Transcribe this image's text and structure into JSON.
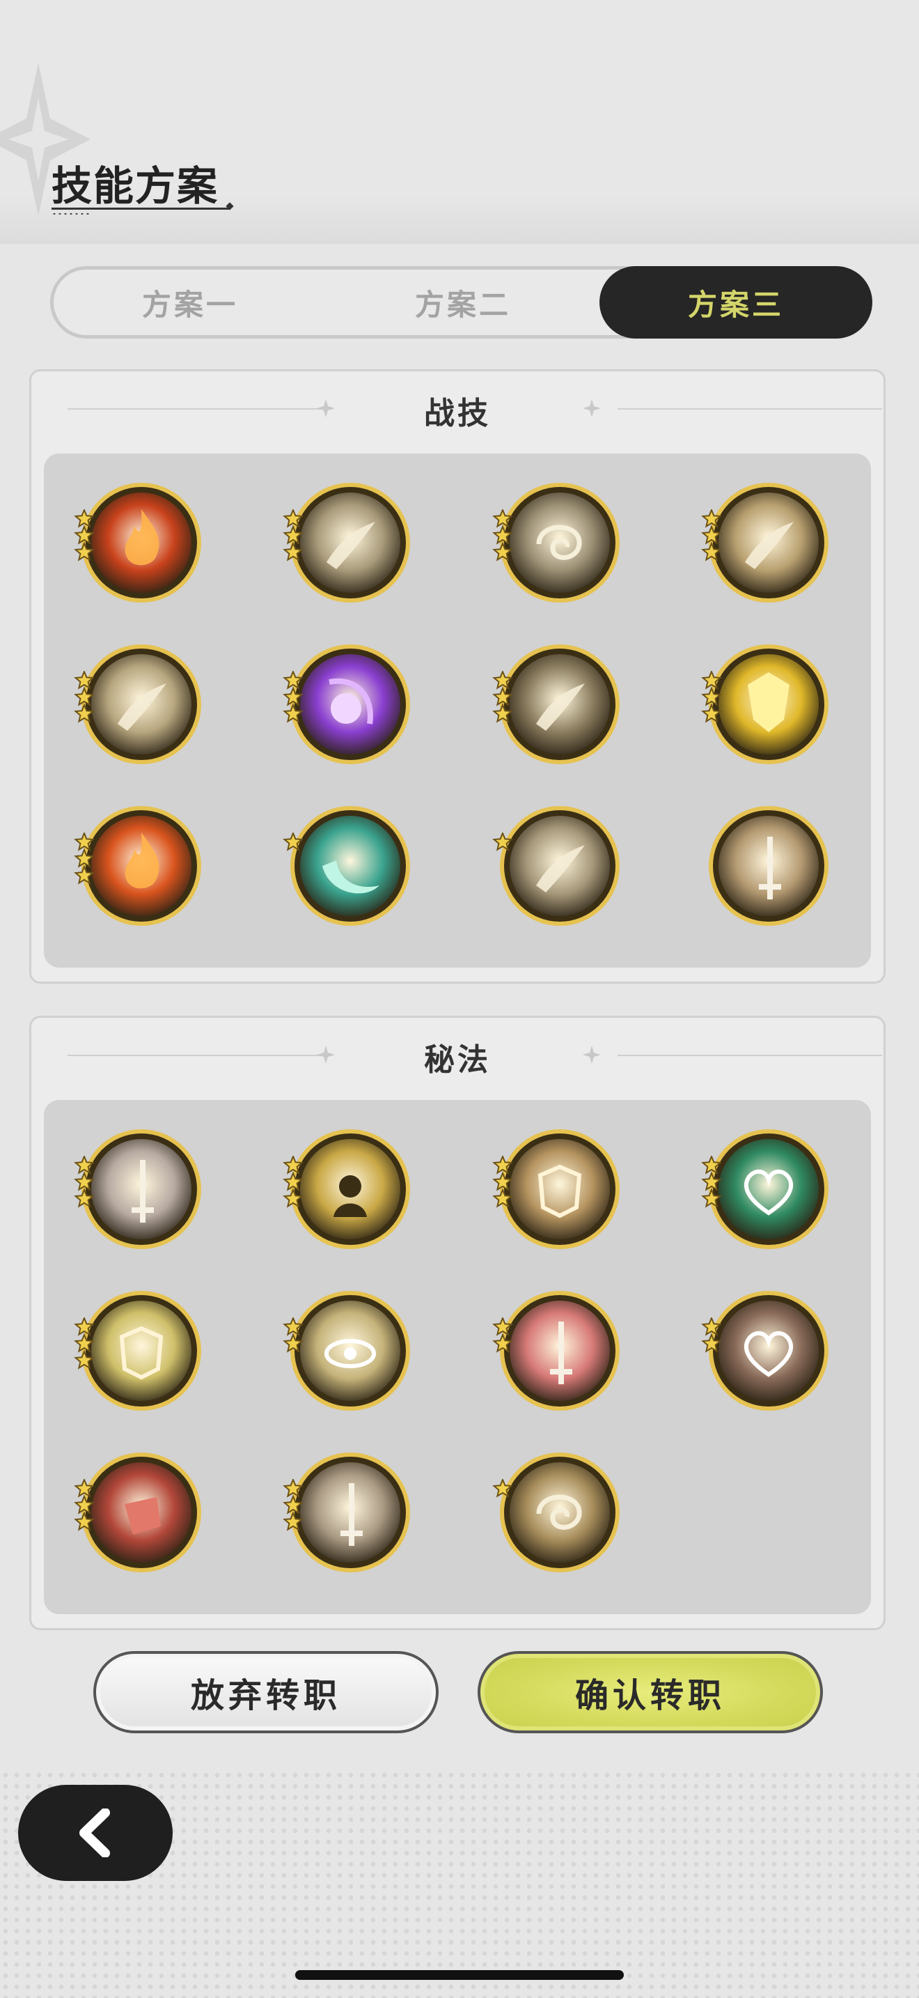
{
  "header": {
    "title": "技能方案"
  },
  "tabs": [
    {
      "label": "方案一",
      "active": false
    },
    {
      "label": "方案二",
      "active": false
    },
    {
      "label": "方案三",
      "active": true
    }
  ],
  "combat_skills": {
    "title": "战技",
    "items": [
      {
        "icon": "flame-icon",
        "stars": 3,
        "accent": "#c8421c"
      },
      {
        "icon": "slash-wind-icon",
        "stars": 3,
        "accent": "#a89a7a"
      },
      {
        "icon": "whirl-icon",
        "stars": 3,
        "accent": "#9b8f74"
      },
      {
        "icon": "burst-icon",
        "stars": 3,
        "accent": "#b8a070"
      },
      {
        "icon": "sweep-icon",
        "stars": 3,
        "accent": "#b7a67f"
      },
      {
        "icon": "arcane-orb-icon",
        "stars": 3,
        "accent": "#8a3fd0"
      },
      {
        "icon": "cross-slash-icon",
        "stars": 3,
        "accent": "#8c7e60"
      },
      {
        "icon": "shield-up-icon",
        "stars": 3,
        "accent": "#e0b82a"
      },
      {
        "icon": "fire-rune-icon",
        "stars": 3,
        "accent": "#d9541e"
      },
      {
        "icon": "wave-icon",
        "stars": 1,
        "accent": "#3aa38e"
      },
      {
        "icon": "impact-icon",
        "stars": 1,
        "accent": "#a6987a"
      },
      {
        "icon": "sword-strike-icon",
        "stars": 0,
        "accent": "#b49a72"
      }
    ]
  },
  "arcane_skills": {
    "title": "秘法",
    "items": [
      {
        "icon": "sword-emblem-icon",
        "stars": 3,
        "accent": "#b7aaa2"
      },
      {
        "icon": "spirit-icon",
        "stars": 3,
        "accent": "#c9a846"
      },
      {
        "icon": "armor-icon",
        "stars": 3,
        "accent": "#b59460"
      },
      {
        "icon": "heart-heal-icon",
        "stars": 3,
        "accent": "#2f8a62"
      },
      {
        "icon": "helmet-heal-icon",
        "stars": 3,
        "accent": "#cfc06a"
      },
      {
        "icon": "eye-icon",
        "stars": 2,
        "accent": "#c5b37a"
      },
      {
        "icon": "sword-heal-icon",
        "stars": 2,
        "accent": "#d77a78"
      },
      {
        "icon": "heart-shield-icon",
        "stars": 2,
        "accent": "#8a6b5a"
      },
      {
        "icon": "red-fist-icon",
        "stars": 3,
        "accent": "#b2473a"
      },
      {
        "icon": "sword-up-icon",
        "stars": 3,
        "accent": "#aa9a84"
      },
      {
        "icon": "vortex-icon",
        "stars": 1,
        "accent": "#a88e5c"
      }
    ]
  },
  "buttons": {
    "abandon": "放弃转职",
    "confirm": "确认转职"
  },
  "back": {
    "icon": "chevron-left-icon"
  },
  "colors": {
    "ring_gold": "#e6c250",
    "ring_dark": "#3a2e14",
    "tab_active_text": "#d4d56a",
    "confirm_btn": "#d3d95a"
  }
}
